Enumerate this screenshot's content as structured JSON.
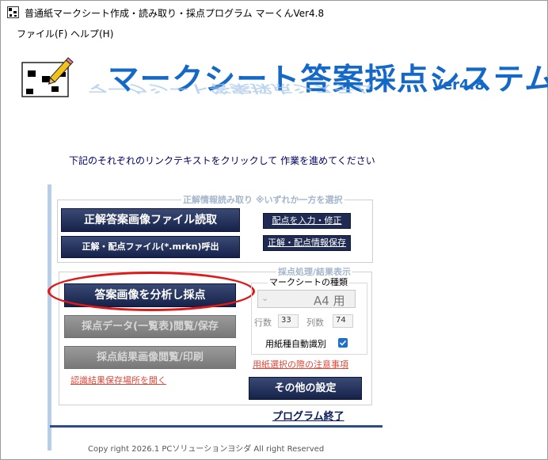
{
  "window": {
    "title": "普通紙マークシート作成・読み取り・採点プログラム マーくんVer4.8"
  },
  "menu": {
    "items": [
      {
        "label": "ファイル(F)"
      },
      {
        "label": "ヘルプ(H)"
      }
    ]
  },
  "header": {
    "title": "マークシート答案採点システム",
    "version": "Ver4.8"
  },
  "instruction": "下記のそれぞれのリンクテキストをクリックして 作業を進めてください",
  "answer_group": {
    "label": "正解情報読み取り ※いずれか一方を選択",
    "read_image_button": "正解答案画像ファイル読取",
    "load_file_button": "正解・配点ファイル(*.mrkn)呼出",
    "input_score_button": "配点を入力・修正",
    "save_info_button": "正解・配点情報保存"
  },
  "grading_group": {
    "label": "採点処理/結果表示",
    "analyze_button": "答案画像を分析し採点",
    "data_view_button": "採点データ(一覧表)閲覧/保存",
    "result_image_button": "採点結果画像閲覧/印刷",
    "open_location_link": "認識結果保存場所を開く",
    "sheet_type_label": "マークシートの種類",
    "sheet_size": "A4 用",
    "rows_label": "行数",
    "rows_value": "33",
    "cols_label": "列数",
    "cols_value": "74",
    "auto_detect_label": "用紙種自動識別",
    "auto_detect_checked": true,
    "paper_note_link": "用紙選択の際の注意事項",
    "other_settings_button": "その他の設定"
  },
  "exit_link": "プログラム終了",
  "copyright": "Copy right 2026.1 PCソリューションヨシダ All right Reserved",
  "colors": {
    "title_blue": "#1468c8",
    "button_dark": "#1f2b52",
    "annotation_red": "#e01818"
  }
}
